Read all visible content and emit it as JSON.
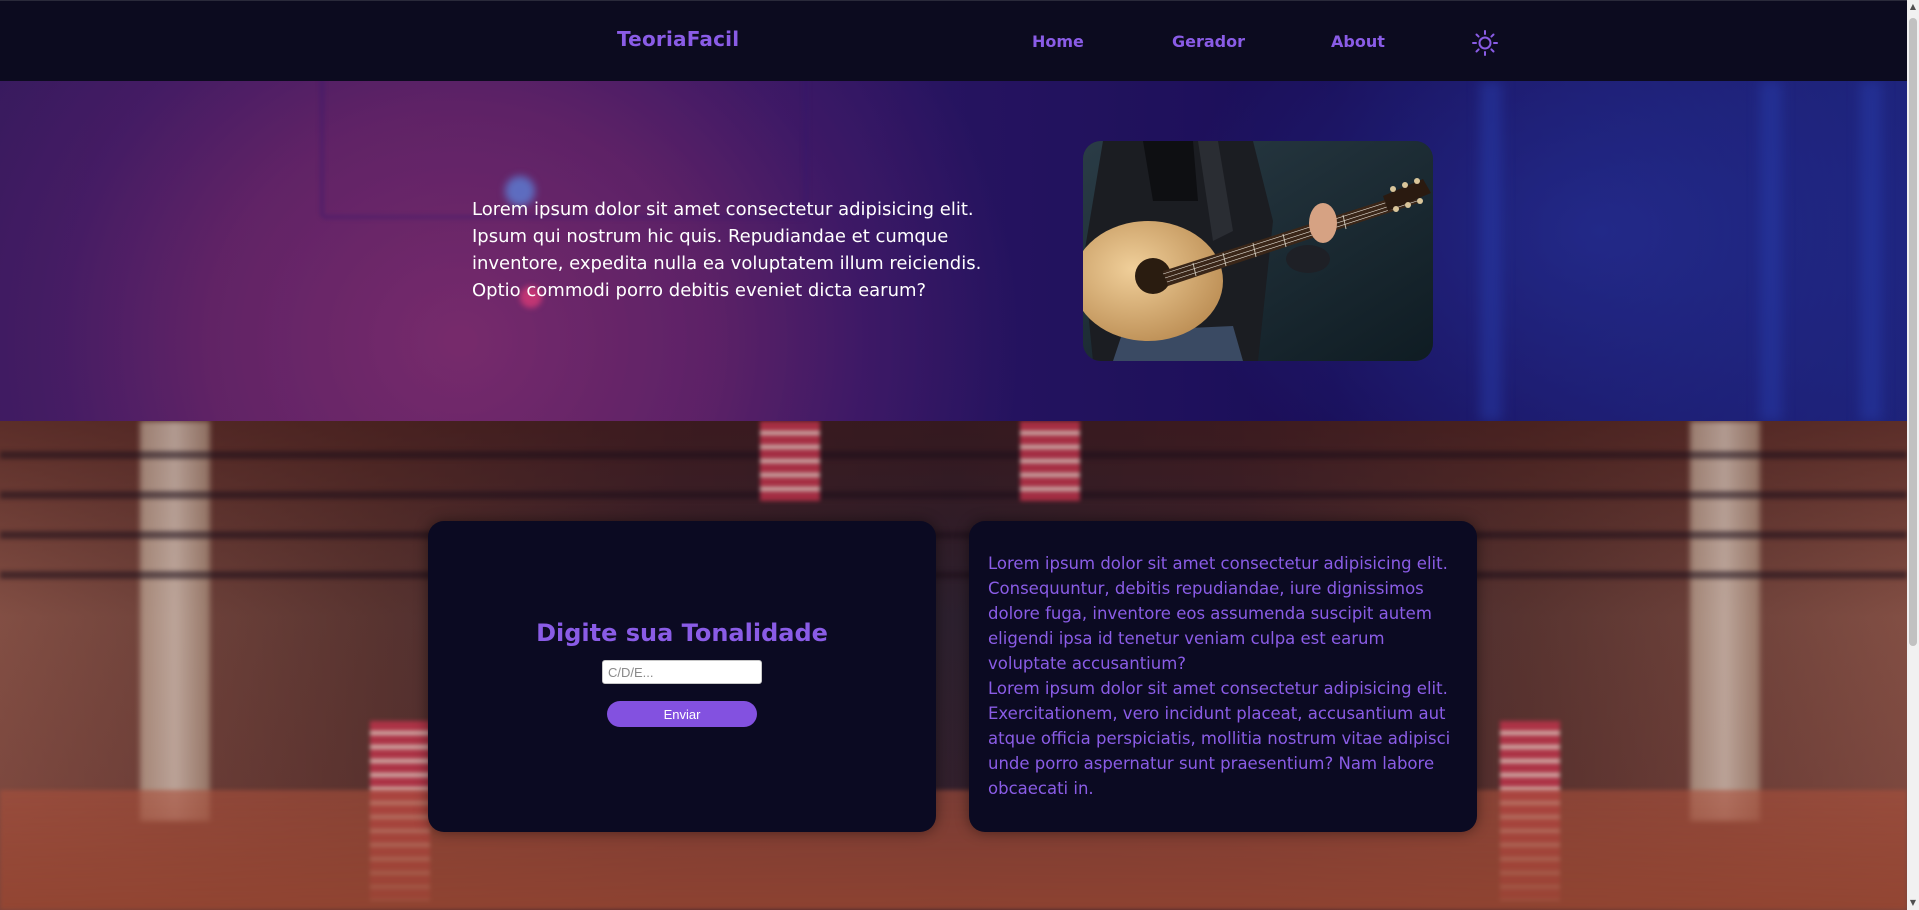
{
  "nav": {
    "brand": "TeoriaFacil",
    "links": [
      "Home",
      "Gerador",
      "About"
    ],
    "theme_icon": "sun-icon"
  },
  "hero": {
    "text": "Lorem ipsum dolor sit amet consectetur adipisicing elit. Ipsum qui nostrum hic quis. Repudiandae et cumque inventore, expedita nulla ea voluptatem illum reiciendis. Optio commodi porro debitis eveniet dicta earum?"
  },
  "form": {
    "title": "Digite sua Tonalidade",
    "input_placeholder": "C/D/E...",
    "input_value": "",
    "submit_label": "Enviar"
  },
  "info": {
    "paragraphs": [
      "Lorem ipsum dolor sit amet consectetur adipisicing elit. Consequuntur, debitis repudiandae, iure dignissimos dolore fuga, inventore eos assumenda suscipit autem eligendi ipsa id tenetur veniam culpa est earum voluptate accusantium?",
      "Lorem ipsum dolor sit amet consectetur adipisicing elit. Exercitationem, vero incidunt placeat, accusantium aut atque officia perspiciatis, mollitia nostrum vitae adipisci unde porro aspernatur sunt praesentium? Nam labore obcaecati in."
    ]
  },
  "colors": {
    "accent": "#8a5ce6",
    "button": "#8351e0",
    "nav_bg": "#0c0b1f",
    "card_bg": "#0b0a22"
  }
}
